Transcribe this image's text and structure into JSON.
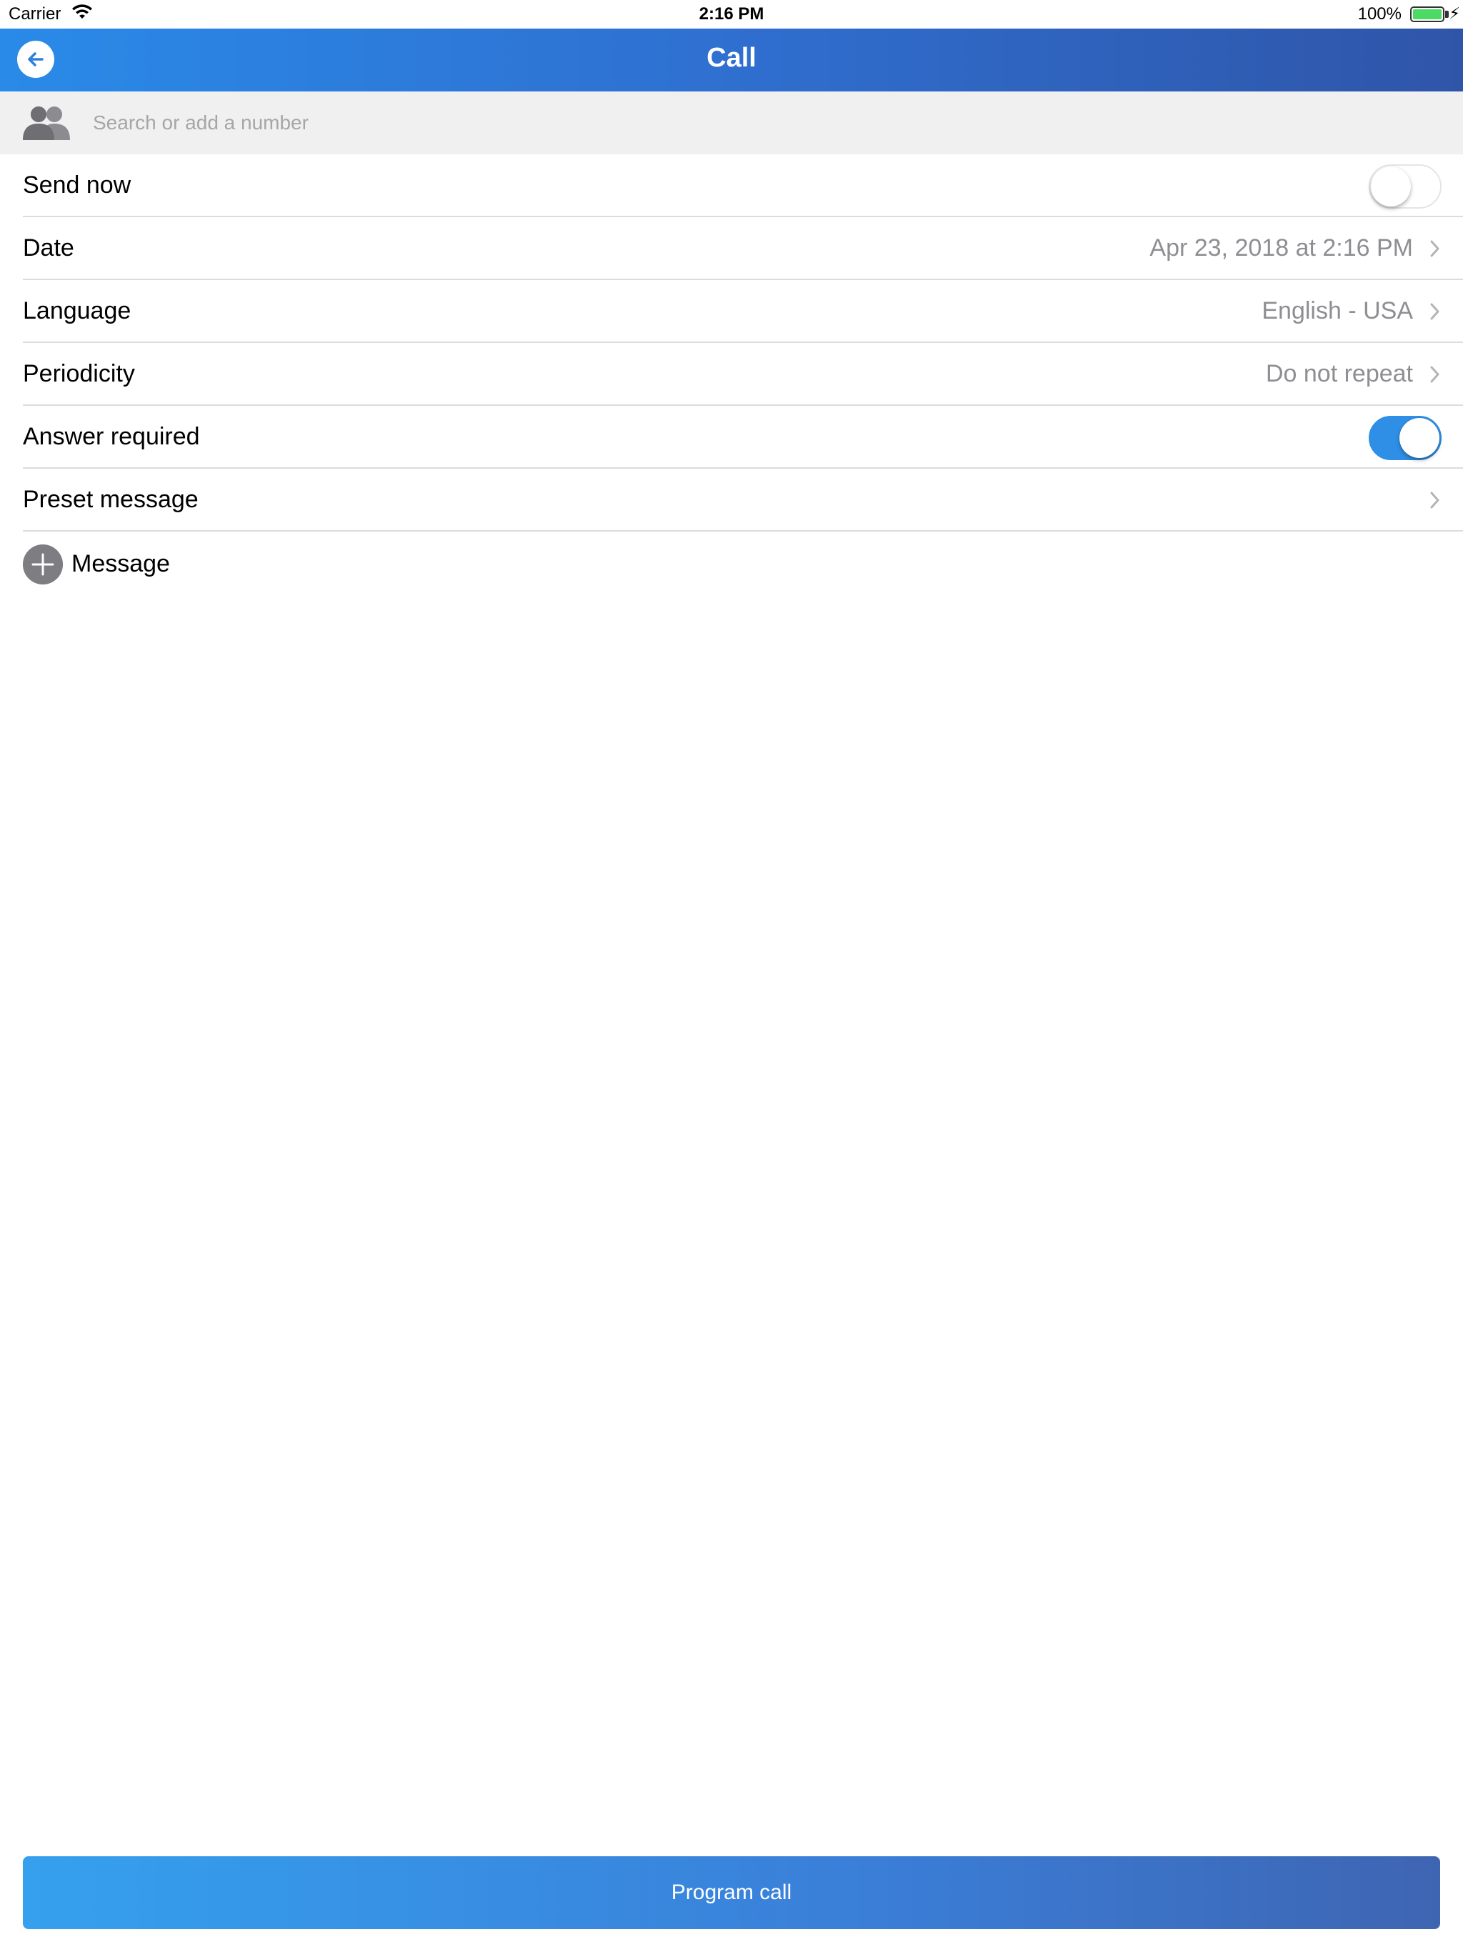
{
  "status_bar": {
    "carrier": "Carrier",
    "time": "2:16 PM",
    "battery_percent": "100%",
    "battery_color": "#4cd964"
  },
  "nav": {
    "title": "Call",
    "back_icon": "back-arrow-icon"
  },
  "search": {
    "placeholder": "Search or add a number",
    "value": "",
    "icon": "contacts-icon"
  },
  "rows": {
    "send_now": {
      "label": "Send now",
      "on": false
    },
    "date": {
      "label": "Date",
      "value": "Apr 23, 2018 at 2:16 PM"
    },
    "language": {
      "label": "Language",
      "value": "English - USA"
    },
    "periodicity": {
      "label": "Periodicity",
      "value": "Do not repeat"
    },
    "answer_required": {
      "label": "Answer required",
      "on": true
    },
    "preset_message": {
      "label": "Preset message",
      "value": ""
    }
  },
  "message": {
    "label": "Message",
    "icon": "add-circle-icon"
  },
  "actions": {
    "program_call_label": "Program call"
  },
  "colors": {
    "nav_gradient_start": "#2a8ae8",
    "nav_gradient_end": "#2f55a8",
    "toggle_on": "#2f8fe6",
    "secondary_text": "#8e8e93"
  }
}
